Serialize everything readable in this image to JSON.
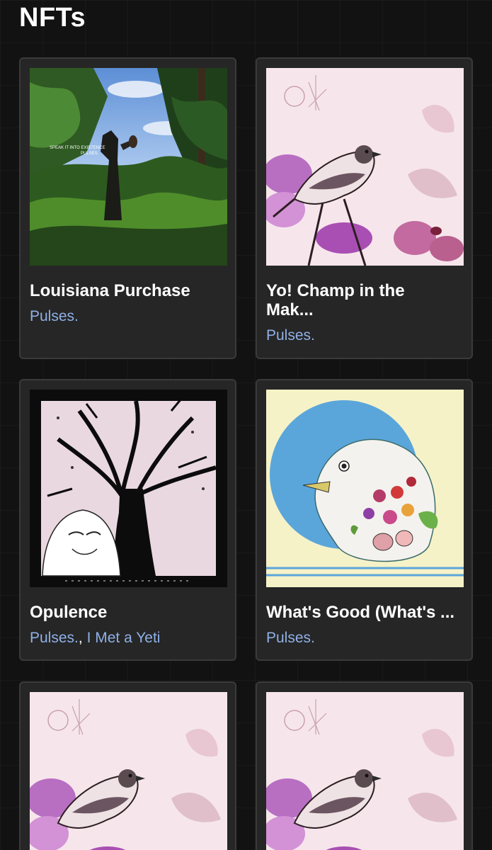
{
  "page": {
    "title": "NFTs"
  },
  "colors": {
    "background": "#121212",
    "card": "#262626",
    "link": "#8fb0e6"
  },
  "cards": [
    {
      "title": "Louisiana Purchase",
      "artists": [
        "Pulses."
      ],
      "art_text_line1": "SPEAK IT INTO EXISTENCE",
      "art_text_line2": "PULSES."
    },
    {
      "title": "Yo! Champ in the Mak...",
      "artists": [
        "Pulses."
      ]
    },
    {
      "title": "Opulence",
      "artists": [
        "Pulses.",
        "I Met a Yeti"
      ],
      "separator": ","
    },
    {
      "title": "What's Good (What's ...",
      "artists": [
        "Pulses."
      ]
    },
    {
      "title": "",
      "artists": []
    },
    {
      "title": "",
      "artists": []
    }
  ]
}
